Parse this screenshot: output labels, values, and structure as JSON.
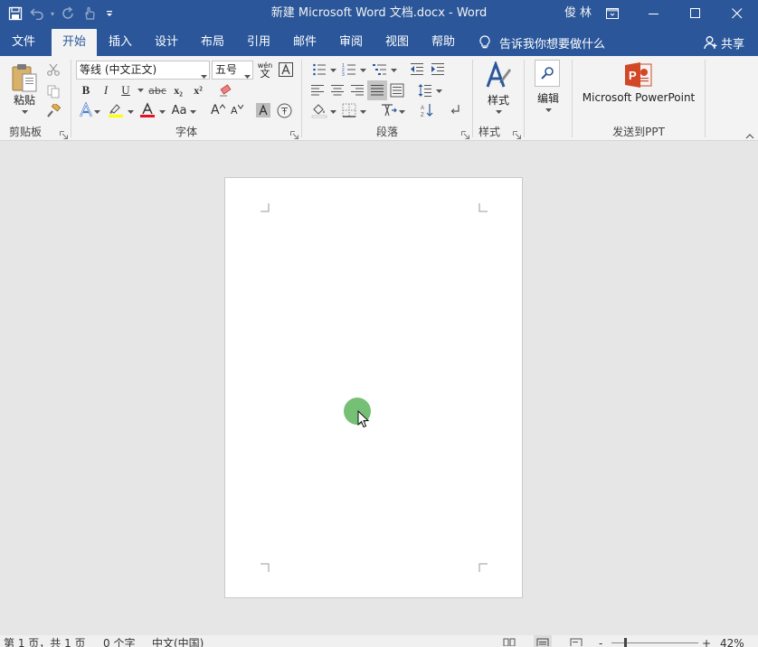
{
  "title_bar": {
    "doc_title": "新建 Microsoft Word 文档.docx  -  Word",
    "user_name": "俊林"
  },
  "tabs": [
    {
      "label": "文件",
      "active": false
    },
    {
      "label": "开始",
      "active": true
    },
    {
      "label": "插入",
      "active": false
    },
    {
      "label": "设计",
      "active": false
    },
    {
      "label": "布局",
      "active": false
    },
    {
      "label": "引用",
      "active": false
    },
    {
      "label": "邮件",
      "active": false
    },
    {
      "label": "审阅",
      "active": false
    },
    {
      "label": "视图",
      "active": false
    },
    {
      "label": "帮助",
      "active": false
    }
  ],
  "tell_me": {
    "label": "告诉我你想要做什么"
  },
  "share": {
    "label": "共享"
  },
  "ribbon": {
    "clipboard": {
      "label": "剪贴板",
      "paste_label": "粘贴"
    },
    "font": {
      "label": "字体",
      "font_name": "等线 (中文正文)",
      "font_size": "五号",
      "bold": "B",
      "italic": "I",
      "underline": "U",
      "strike": "abc",
      "subscript": "x₂",
      "superscript": "x²",
      "grow": "A",
      "shrink": "A",
      "change_case": "Aa",
      "phonetic": "wén",
      "phonetic_sub": "文"
    },
    "paragraph": {
      "label": "段落"
    },
    "styles": {
      "label": "样式",
      "button_label": "样式"
    },
    "editing": {
      "button_label": "编辑"
    },
    "send_ppt": {
      "label": "发送到PPT",
      "button_label": "Microsoft PowerPoint"
    }
  },
  "statusbar": {
    "page_info": "第 1 页，共 1 页",
    "word_count": "0 个字",
    "language": "中文(中国)",
    "zoom_minus": "-",
    "zoom_plus": "+",
    "zoom": "42%",
    "zoom_value_percent": 42
  },
  "colors": {
    "word_blue": "#2b579a",
    "ribbon_bg": "#f3f3f3",
    "canvas_bg": "#e6e6e6",
    "highlight_yellow": "#ffff00",
    "font_red": "#e81123",
    "ppt_orange": "#d24726",
    "cursor_dot": "#6fbd6f"
  }
}
